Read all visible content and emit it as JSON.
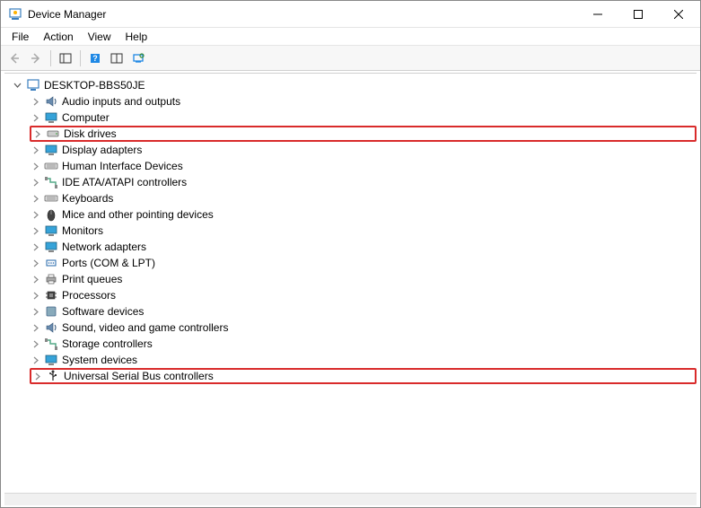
{
  "window": {
    "title": "Device Manager"
  },
  "menu": {
    "file": "File",
    "action": "Action",
    "view": "View",
    "help": "Help"
  },
  "tree": {
    "root": "DESKTOP-BBS50JE",
    "items": [
      {
        "label": "Audio inputs and outputs",
        "icon": "audio"
      },
      {
        "label": "Computer",
        "icon": "monitor"
      },
      {
        "label": "Disk drives",
        "icon": "disk",
        "highlight": true
      },
      {
        "label": "Display adapters",
        "icon": "monitor"
      },
      {
        "label": "Human Interface Devices",
        "icon": "keyboard"
      },
      {
        "label": "IDE ATA/ATAPI controllers",
        "icon": "cable"
      },
      {
        "label": "Keyboards",
        "icon": "keyboard"
      },
      {
        "label": "Mice and other pointing devices",
        "icon": "mouse"
      },
      {
        "label": "Monitors",
        "icon": "monitor"
      },
      {
        "label": "Network adapters",
        "icon": "monitor"
      },
      {
        "label": "Ports (COM & LPT)",
        "icon": "port"
      },
      {
        "label": "Print queues",
        "icon": "printer"
      },
      {
        "label": "Processors",
        "icon": "chip"
      },
      {
        "label": "Software devices",
        "icon": "generic"
      },
      {
        "label": "Sound, video and game controllers",
        "icon": "audio"
      },
      {
        "label": "Storage controllers",
        "icon": "cable"
      },
      {
        "label": "System devices",
        "icon": "monitor"
      },
      {
        "label": "Universal Serial Bus controllers",
        "icon": "usb",
        "highlight": true
      }
    ]
  }
}
